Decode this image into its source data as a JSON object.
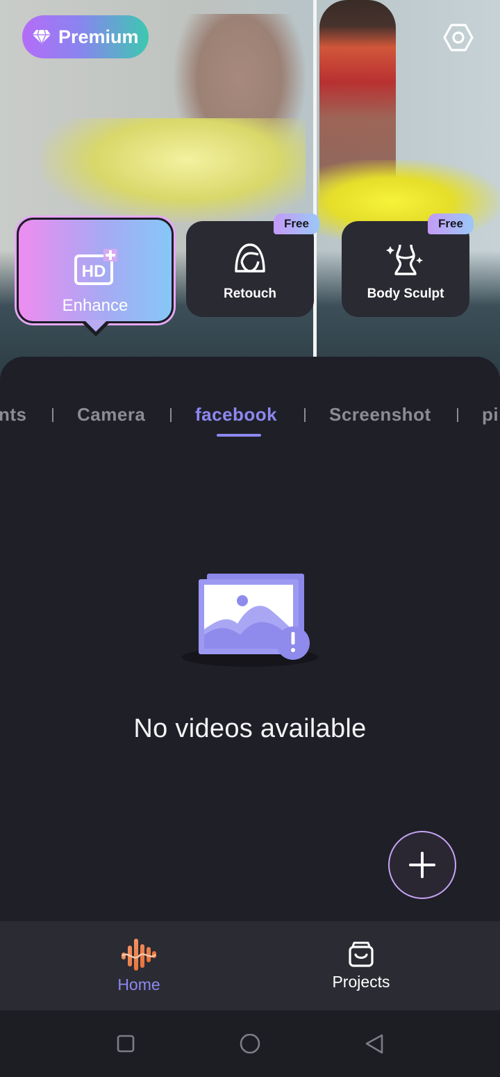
{
  "header": {
    "premium_label": "Premium",
    "settings_icon": "settings-hexagon-icon"
  },
  "tools": [
    {
      "label": "Enhance",
      "icon": "hd-enhance-icon",
      "selected": true
    },
    {
      "label": "Retouch",
      "icon": "face-retouch-icon",
      "badge": "Free"
    },
    {
      "label": "Body Sculpt",
      "icon": "body-sculpt-icon",
      "badge": "Free"
    }
  ],
  "tabs": [
    {
      "label": "nts"
    },
    {
      "label": "Camera"
    },
    {
      "label": "facebook",
      "active": true
    },
    {
      "label": "Screenshot"
    },
    {
      "label": "pi"
    }
  ],
  "empty_state": {
    "message": "No videos available",
    "icon": "no-media-image-icon"
  },
  "fab": {
    "icon": "plus-icon"
  },
  "bottom_nav": [
    {
      "label": "Home",
      "icon": "home-wave-icon",
      "active": true
    },
    {
      "label": "Projects",
      "icon": "projects-box-icon"
    }
  ],
  "system_nav": [
    "recents-square-icon",
    "home-circle-icon",
    "back-triangle-icon"
  ],
  "colors": {
    "accent": "#8d88f0",
    "background": "#1f1f27",
    "nav_bar": "#2b2b33"
  }
}
